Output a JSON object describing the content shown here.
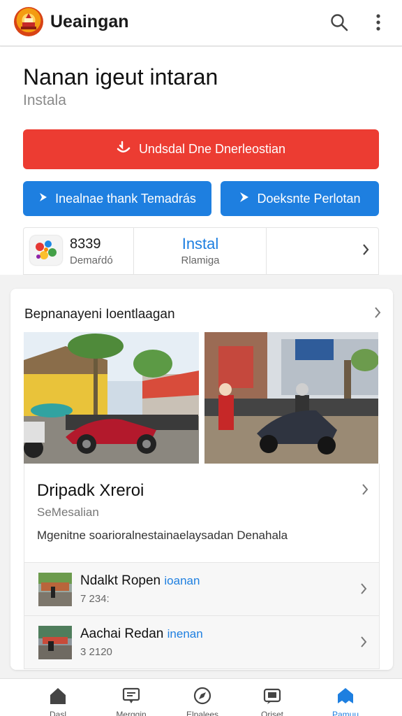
{
  "topbar": {
    "title": "Ueaingan",
    "logo_icon": "temple-logo-icon",
    "search_icon": "search-icon",
    "more_icon": "more-vertical-icon"
  },
  "app": {
    "name": "Nanan igeut intaran",
    "subtitle": "Instala",
    "primary_button": "Undsdal Dne Dnerleostian",
    "secondary_button_1": "Inealnae thank Temadrás",
    "secondary_button_2": "Doeksnte Perlotan",
    "stats": {
      "count_value": "8339",
      "count_label": "Demaŕdó",
      "install_value": "Instal",
      "install_label": "Rlamiga"
    }
  },
  "section": {
    "title": "Bepnanayeni Ioentlaagan",
    "feature": {
      "title": "Dripadk Xreroi",
      "subtitle": "SeMesalian",
      "description": "Mgenitne soarioralnestainaelaysadan Denahala"
    },
    "list": [
      {
        "title": "Ndalkt Ropen",
        "accent": "ioanan",
        "meta": "7 234:"
      },
      {
        "title": "Aachai Redan",
        "accent": "inenan",
        "meta": "3 2120"
      }
    ]
  },
  "bottom_nav": [
    {
      "label": "Dasl",
      "icon": "home-icon"
    },
    {
      "label": "Merggin",
      "icon": "message-icon"
    },
    {
      "label": "Elpalees",
      "icon": "explore-icon"
    },
    {
      "label": "Oriset",
      "icon": "chat-icon"
    },
    {
      "label": "Pamuu",
      "icon": "star-icon"
    }
  ],
  "colors": {
    "primary_red": "#ec3c32",
    "primary_blue": "#1e7fe0",
    "background": "#f2f2f2"
  }
}
